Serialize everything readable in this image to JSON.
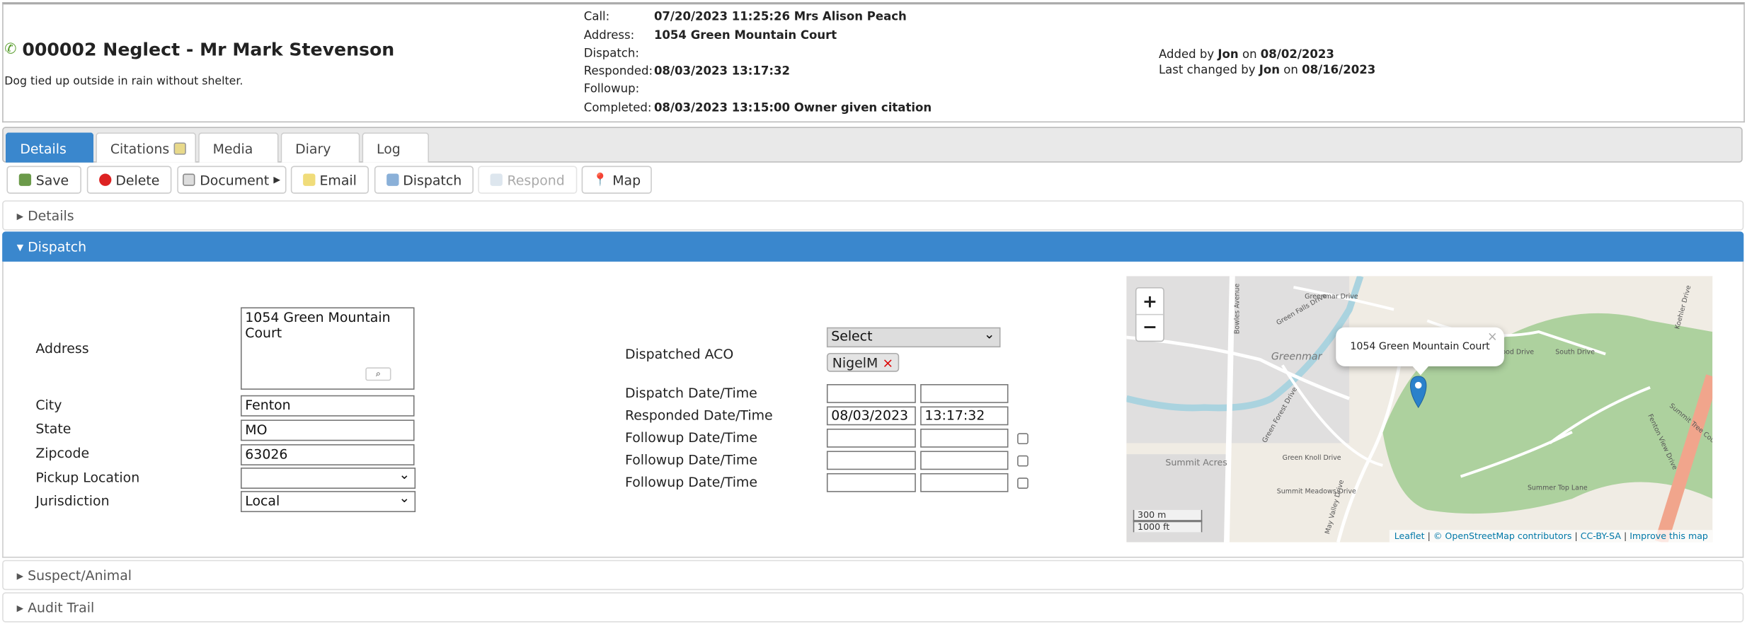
{
  "header": {
    "title": "000002 Neglect - Mr Mark Stevenson",
    "description": "Dog tied up outside in rain without shelter.",
    "meta": [
      {
        "label": "Call:",
        "value": "07/20/2023 11:25:26 Mrs Alison Peach"
      },
      {
        "label": "Address:",
        "value": "1054 Green Mountain Court"
      },
      {
        "label": "Dispatch:",
        "value": ""
      },
      {
        "label": "Responded:",
        "value": "08/03/2023 13:17:32"
      },
      {
        "label": "Followup:",
        "value": ""
      },
      {
        "label": "Completed:",
        "value": "08/03/2023 13:15:00 Owner given citation"
      }
    ],
    "added": {
      "prefix": "Added by ",
      "user": "Jon",
      "on": " on ",
      "date": "08/02/2023"
    },
    "changed": {
      "prefix": "Last changed by ",
      "user": "Jon",
      "on": " on ",
      "date": "08/16/2023"
    }
  },
  "tabs": [
    {
      "label": "Details",
      "active": true
    },
    {
      "label": "Citations"
    },
    {
      "label": "Media"
    },
    {
      "label": "Diary"
    },
    {
      "label": "Log"
    }
  ],
  "toolbar": {
    "save": "Save",
    "delete": "Delete",
    "document": "Document",
    "email": "Email",
    "dispatch": "Dispatch",
    "respond": "Respond",
    "map": "Map"
  },
  "sections": {
    "details": "Details",
    "dispatch": "Dispatch",
    "suspect": "Suspect/Animal",
    "audit": "Audit Trail"
  },
  "form": {
    "address_label": "Address",
    "address": "1054 Green Mountain Court",
    "city_label": "City",
    "city": "Fenton",
    "state_label": "State",
    "state": "MO",
    "zip_label": "Zipcode",
    "zip": "63026",
    "pickup_label": "Pickup Location",
    "pickup": "",
    "jurisdiction_label": "Jurisdiction",
    "jurisdiction": "Local",
    "aco_label": "Dispatched ACO",
    "aco_select": "Select",
    "aco_tag": "NigelM",
    "dispatch_label": "Dispatch Date/Time",
    "dispatch_date": "",
    "dispatch_time": "",
    "responded_label": "Responded Date/Time",
    "responded_date": "08/03/2023",
    "responded_time": "13:17:32",
    "followup_label": "Followup Date/Time"
  },
  "map": {
    "popup": "1054 Green Mountain Court",
    "zoom_in": "+",
    "zoom_out": "−",
    "scale_m": "300 m",
    "scale_ft": "1000 ft",
    "attribution": {
      "leaflet": "Leaflet",
      "osm": "© OpenStreetMap contributors",
      "license": "CC-BY-SA",
      "improve": "Improve this map"
    },
    "labels": [
      "Greenmar Drive",
      "Oakwood Drive",
      "South Drive",
      "Greenmar",
      "Green Knoll Drive",
      "Green Forest Drive",
      "Summit Meadows Drive",
      "Summit Acres",
      "Bowles Avenue",
      "May Valley Drive",
      "Summer Top Lane",
      "Fenton View Drive",
      "Summit Tree Court",
      "Green Falls Drive",
      "Koehler Drive"
    ]
  },
  "colors": {
    "accent": "#3a87cd",
    "marker": "#2a81cb",
    "park": "#add19e"
  }
}
